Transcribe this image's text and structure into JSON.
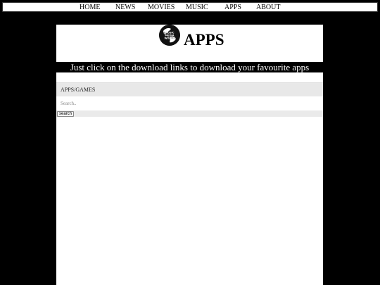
{
  "nav": {
    "items": [
      {
        "label": "HOME"
      },
      {
        "label": "NEWS"
      },
      {
        "label": "MOVIES"
      },
      {
        "label": "MUSIC"
      },
      {
        "label": "APPS"
      },
      {
        "label": "ABOUT"
      }
    ]
  },
  "header": {
    "logo_icon": "globe-logo-icon",
    "logo_text": "MUSIC MEDIA WORLD",
    "title": "APPS"
  },
  "banner": {
    "text": "Just click on the download links to download your favourite apps"
  },
  "section": {
    "label": "APPS/GAMES"
  },
  "search": {
    "placeholder": "Search..",
    "value": "",
    "button_label": "search"
  }
}
